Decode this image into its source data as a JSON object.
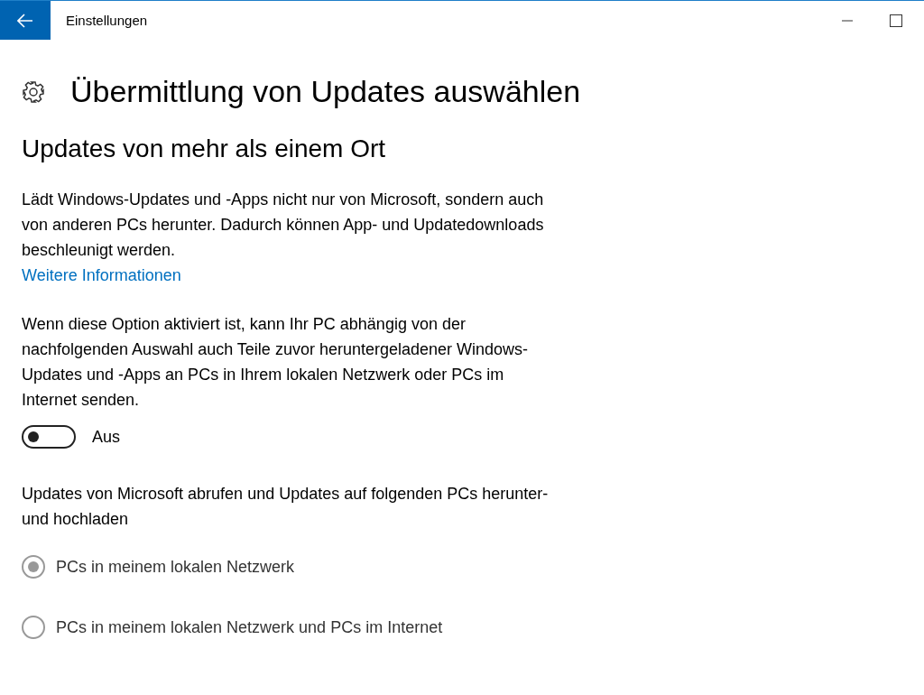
{
  "window": {
    "title": "Einstellungen"
  },
  "page": {
    "title": "Übermittlung von Updates auswählen"
  },
  "section": {
    "title": "Updates von mehr als einem Ort",
    "description": "Lädt Windows-Updates und -Apps nicht nur von Microsoft, sondern auch von anderen PCs herunter. Dadurch können App- und Updatedownloads beschleunigt werden.",
    "link": "Weitere Informationen",
    "option_description": "Wenn diese Option aktiviert ist, kann Ihr PC abhängig von der nachfolgenden Auswahl auch Teile zuvor heruntergeladener Windows-Updates und -Apps an PCs in Ihrem lokalen Netzwerk oder PCs im Internet senden.",
    "toggle": {
      "on": false,
      "label": "Aus"
    },
    "choice_label": "Updates von Microsoft abrufen und Updates auf folgenden PCs herunter- und hochladen",
    "radios": [
      {
        "label": "PCs in meinem lokalen Netzwerk",
        "selected": true,
        "disabled": true
      },
      {
        "label": "PCs in meinem lokalen Netzwerk und PCs im Internet",
        "selected": false,
        "disabled": true
      }
    ]
  }
}
